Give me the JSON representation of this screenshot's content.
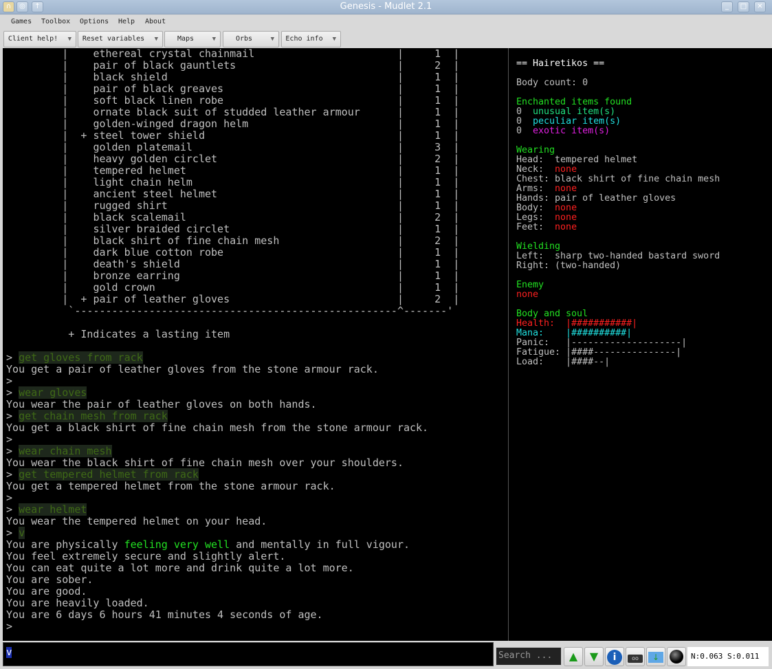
{
  "window": {
    "title": "Genesis - Mudlet 2.1"
  },
  "menu": [
    "Games",
    "Toolbox",
    "Options",
    "Help",
    "About"
  ],
  "toolbar": [
    "Client help!",
    "Reset variables",
    "Maps",
    "Orbs",
    "Echo info"
  ],
  "colors": {
    "command": "#3f6a16",
    "command_bg": "#1e281c",
    "highlight_green": "#22e022",
    "red": "#ff2020",
    "cyan": "#20e0e0",
    "magenta": "#e020e0",
    "teal": "#20e080",
    "heading": "#22e022"
  },
  "inventory": {
    "items": [
      {
        "name": "ethereal crystal chainmail",
        "count": 1,
        "lasting": false
      },
      {
        "name": "pair of black gauntlets",
        "count": 2,
        "lasting": false
      },
      {
        "name": "black shield",
        "count": 1,
        "lasting": false
      },
      {
        "name": "pair of black greaves",
        "count": 1,
        "lasting": false
      },
      {
        "name": "soft black linen robe",
        "count": 1,
        "lasting": false
      },
      {
        "name": "ornate black suit of studded leather armour",
        "count": 1,
        "lasting": false
      },
      {
        "name": "golden-winged dragon helm",
        "count": 1,
        "lasting": false
      },
      {
        "name": "steel tower shield",
        "count": 1,
        "lasting": true
      },
      {
        "name": "golden platemail",
        "count": 3,
        "lasting": false
      },
      {
        "name": "heavy golden circlet",
        "count": 2,
        "lasting": false
      },
      {
        "name": "tempered helmet",
        "count": 1,
        "lasting": false
      },
      {
        "name": "light chain helm",
        "count": 1,
        "lasting": false
      },
      {
        "name": "ancient steel helmet",
        "count": 1,
        "lasting": false
      },
      {
        "name": "rugged shirt",
        "count": 1,
        "lasting": false
      },
      {
        "name": "black scalemail",
        "count": 2,
        "lasting": false
      },
      {
        "name": "silver braided circlet",
        "count": 1,
        "lasting": false
      },
      {
        "name": "black shirt of fine chain mesh",
        "count": 2,
        "lasting": false
      },
      {
        "name": "dark blue cotton robe",
        "count": 1,
        "lasting": false
      },
      {
        "name": "death's shield",
        "count": 1,
        "lasting": false
      },
      {
        "name": "bronze earring",
        "count": 1,
        "lasting": false
      },
      {
        "name": "gold crown",
        "count": 1,
        "lasting": false
      },
      {
        "name": "pair of leather gloves",
        "count": 2,
        "lasting": true
      }
    ],
    "legend": "+ Indicates a lasting item"
  },
  "log": [
    {
      "cmd": "get gloves from rack"
    },
    {
      "out": [
        {
          "t": "You get a pair of leather gloves from the stone armour rack."
        }
      ]
    },
    {
      "prompt": true
    },
    {
      "cmd": "wear gloves"
    },
    {
      "out": [
        {
          "t": "You wear the pair of leather gloves on both hands."
        }
      ]
    },
    {
      "cmd": "get chain mesh from rack"
    },
    {
      "out": [
        {
          "t": "You get a black shirt of fine chain mesh from the stone armour rack."
        }
      ]
    },
    {
      "prompt": true
    },
    {
      "cmd": "wear chain mesh"
    },
    {
      "out": [
        {
          "t": "You wear the black shirt of fine chain mesh over your shoulders."
        }
      ]
    },
    {
      "cmd": "get tempered helmet from rack"
    },
    {
      "out": [
        {
          "t": "You get a tempered helmet from the stone armour rack."
        }
      ]
    },
    {
      "prompt": true
    },
    {
      "cmd": "wear helmet"
    },
    {
      "out": [
        {
          "t": "You wear the tempered helmet on your head."
        }
      ]
    },
    {
      "cmd": "v"
    },
    {
      "out": [
        {
          "t": "You are physically "
        },
        {
          "t": "feeling very well",
          "hl": true
        },
        {
          "t": " and mentally in full vigour."
        }
      ]
    },
    {
      "out": [
        {
          "t": "You feel extremely secure and slightly alert."
        }
      ]
    },
    {
      "out": [
        {
          "t": "You can eat quite a lot more and drink quite a lot more."
        }
      ]
    },
    {
      "out": [
        {
          "t": "You are sober."
        }
      ]
    },
    {
      "out": [
        {
          "t": "You are good."
        }
      ]
    },
    {
      "out": [
        {
          "t": "You are heavily loaded."
        }
      ]
    },
    {
      "out": [
        {
          "t": "You are 6 days 6 hours 41 minutes 4 seconds of age."
        }
      ]
    },
    {
      "prompt": true
    }
  ],
  "sidebar": [
    [
      {
        "t": "== Hairetikos ==",
        "c": "#ffffff"
      }
    ],
    [],
    [
      {
        "t": "Body count: 0"
      }
    ],
    [],
    [
      {
        "t": "Enchanted items found",
        "c": "heading"
      }
    ],
    [
      {
        "t": "0  "
      },
      {
        "t": "unusual item(s)",
        "c": "teal"
      }
    ],
    [
      {
        "t": "0  "
      },
      {
        "t": "peculiar item(s)",
        "c": "cyan"
      }
    ],
    [
      {
        "t": "0  "
      },
      {
        "t": "exotic item(s)",
        "c": "magenta"
      }
    ],
    [],
    [
      {
        "t": "Wearing",
        "c": "heading"
      }
    ],
    [
      {
        "t": "Head:  tempered helmet"
      }
    ],
    [
      {
        "t": "Neck:  "
      },
      {
        "t": "none",
        "c": "red"
      }
    ],
    [
      {
        "t": "Chest: black shirt of fine chain mesh"
      }
    ],
    [
      {
        "t": "Arms:  "
      },
      {
        "t": "none",
        "c": "red"
      }
    ],
    [
      {
        "t": "Hands: pair of leather gloves"
      }
    ],
    [
      {
        "t": "Body:  "
      },
      {
        "t": "none",
        "c": "red"
      }
    ],
    [
      {
        "t": "Legs:  "
      },
      {
        "t": "none",
        "c": "red"
      }
    ],
    [
      {
        "t": "Feet:  "
      },
      {
        "t": "none",
        "c": "red"
      }
    ],
    [],
    [
      {
        "t": "Wielding",
        "c": "heading"
      }
    ],
    [
      {
        "t": "Left:  sharp two-handed bastard sword"
      }
    ],
    [
      {
        "t": "Right: (two-handed)"
      }
    ],
    [],
    [
      {
        "t": "Enemy",
        "c": "heading"
      }
    ],
    [
      {
        "t": "none",
        "c": "red"
      }
    ],
    [],
    [
      {
        "t": "Body and soul",
        "c": "heading"
      }
    ],
    [
      {
        "t": "Health:  |###########|",
        "c": "red"
      }
    ],
    [
      {
        "t": "Mana:    |##########|",
        "c": "cyan"
      }
    ],
    [
      {
        "t": "Panic:   |--------------------|"
      }
    ],
    [
      {
        "t": "Fatigue: |####---------------|"
      }
    ],
    [
      {
        "t": "Load:    |####--|"
      }
    ]
  ],
  "input": {
    "value": "v"
  },
  "search": {
    "placeholder": "Search ..."
  },
  "status": {
    "text": "N:0.063 S:0.011"
  }
}
